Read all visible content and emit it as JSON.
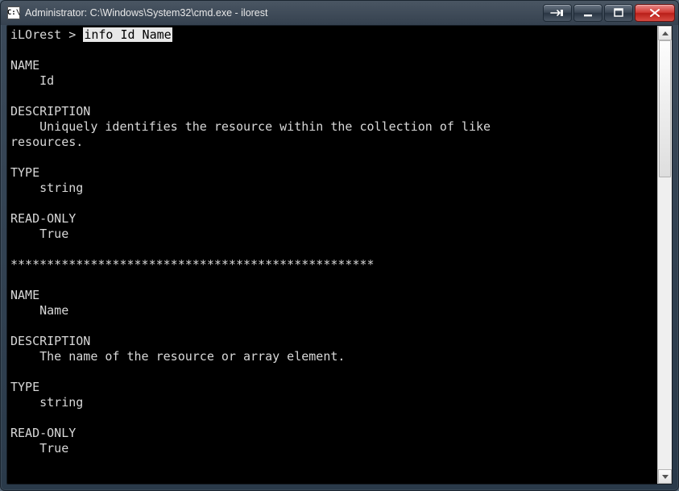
{
  "window": {
    "title": "Administrator: C:\\Windows\\System32\\cmd.exe - ilorest",
    "icon_label": "C:\\"
  },
  "console": {
    "prompt_prefix": "iLOrest > ",
    "command": "info Id Name",
    "divider": "**************************************************",
    "fields": [
      {
        "section": "NAME",
        "value": "Id"
      },
      {
        "section": "DESCRIPTION",
        "value": "Uniquely identifies the resource within the collection of like\nresources."
      },
      {
        "section": "TYPE",
        "value": "string"
      },
      {
        "section": "READ-ONLY",
        "value": "True"
      }
    ],
    "fields2": [
      {
        "section": "NAME",
        "value": "Name"
      },
      {
        "section": "DESCRIPTION",
        "value": "The name of the resource or array element."
      },
      {
        "section": "TYPE",
        "value": "string"
      },
      {
        "section": "READ-ONLY",
        "value": "True"
      }
    ]
  }
}
